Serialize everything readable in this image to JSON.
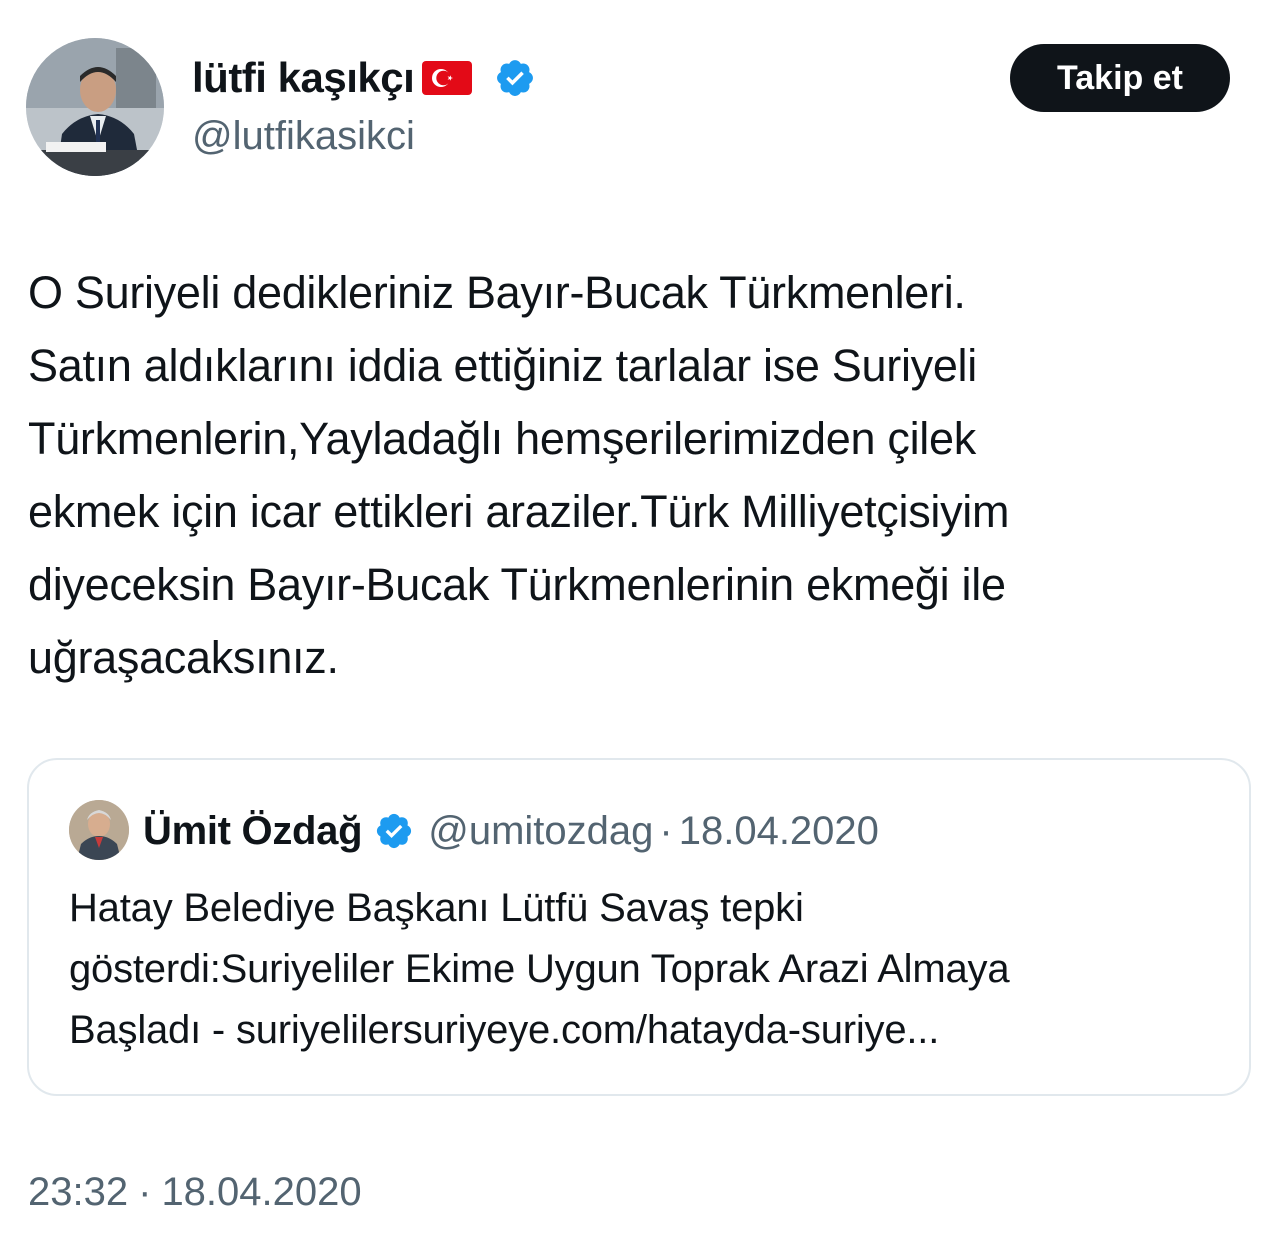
{
  "author": {
    "display_name": "lütfi kaşıkçı",
    "handle": "@lutfikasikci",
    "flag_icon": "turkey-flag-icon",
    "verified_icon": "verified-badge-icon"
  },
  "follow_button": {
    "label": "Takip et"
  },
  "tweet": {
    "text": "O Suriyeli dedikleriniz Bayır-Bucak Türkmenleri.\nSatın aldıklarını iddia ettiğiniz tarlalar ise Suriyeli\nTürkmenlerin,Yayladağlı hemşerilerimizden çilek\nekmek için icar ettikleri araziler.Türk Milliyetçisiyim\ndiyeceksin Bayır-Bucak Türkmenlerinin ekmeği ile\nuğraşacaksınız."
  },
  "quote": {
    "display_name": "Ümit Özdağ",
    "handle": "@umitozdag",
    "separator": "·",
    "date": "18.04.2020",
    "text": "Hatay Belediye Başkanı Lütfü Savaş tepki\ngösterdi:Suriyeliler Ekime Uygun Toprak Arazi Almaya\nBaşladı - suriyelilersuriyeye.com/hatayda-suriye..."
  },
  "meta": {
    "time": "23:32",
    "separator": "·",
    "date": "18.04.2020"
  },
  "colors": {
    "text_primary": "#0f1419",
    "text_secondary": "#536471",
    "verified_blue": "#1d9bf0",
    "button_bg": "#0f1419",
    "border": "#e1e8ed",
    "flag_red": "#e30a17"
  }
}
